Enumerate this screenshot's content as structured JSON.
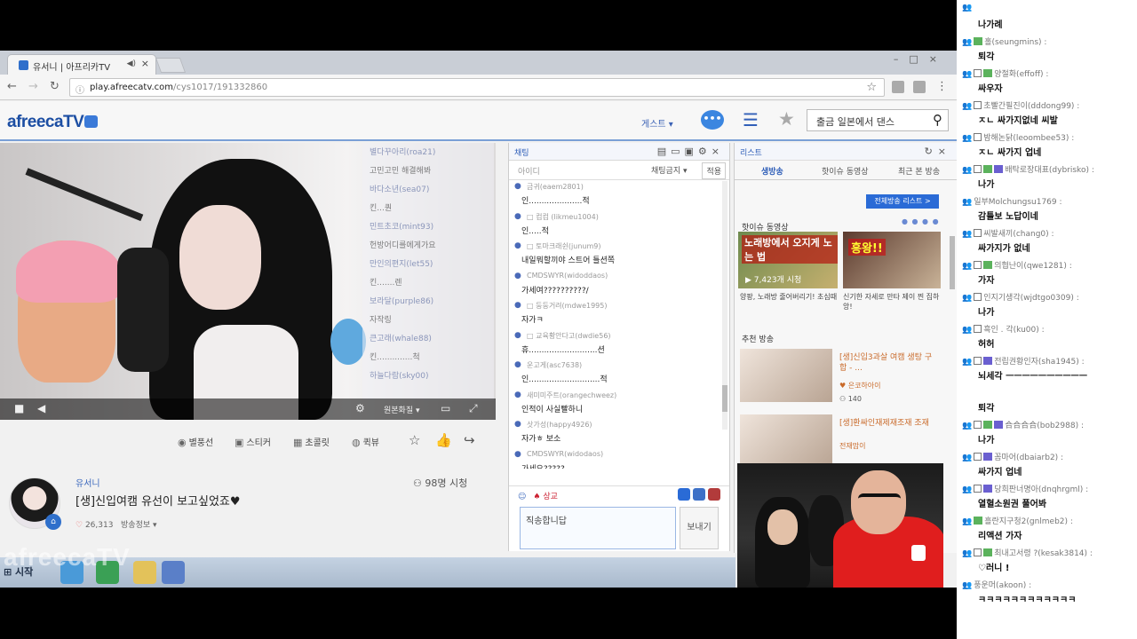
{
  "browser": {
    "tab_title": "유서니 | 아프리카TV",
    "address_host": "play.afreecatv.com",
    "address_path": "/cys1017/191332860"
  },
  "site": {
    "logo": "afreecaTV",
    "guest_label": "게스트 ▾",
    "search_value": "출금 일본에서 댄스"
  },
  "video": {
    "quality_label": "원본화질 ▾",
    "overlay_chat": [
      {
        "nick": "별다꾸아리(roa21)",
        "msg": ""
      },
      {
        "nick": "",
        "msg": "고민고민 해결해봐"
      },
      {
        "nick": "바다소년(sea07)",
        "msg": ""
      },
      {
        "nick": "",
        "msg": "킨...퀀"
      },
      {
        "nick": "민트초코(mint93)",
        "msg": ""
      },
      {
        "nick": "",
        "msg": "헌방어디를에게가요"
      },
      {
        "nick": "만인의편지(let55)",
        "msg": ""
      },
      {
        "nick": "",
        "msg": "킨.......렌"
      },
      {
        "nick": "보라달(purple86)",
        "msg": ""
      },
      {
        "nick": "",
        "msg": "자작링"
      },
      {
        "nick": "큰고래(whale88)",
        "msg": ""
      },
      {
        "nick": "",
        "msg": "킨..............척"
      },
      {
        "nick": "하늘다람(sky00)",
        "msg": ""
      }
    ]
  },
  "actions": {
    "broadcast": "별풍선",
    "sticker": "스티커",
    "chocolate": "초콜릿",
    "quickview": "퀵뷰"
  },
  "streamer": {
    "name": "유서니",
    "title": "[생]신입여캠 유선이 보고싶었죠♥",
    "recommend_count": "26,313",
    "info_label": "방송정보 ▾",
    "viewers": "98명 시청"
  },
  "chat": {
    "title": "채팅",
    "id_placeholder": "아이디",
    "select_label": "채팅금지 ▾",
    "apply_label": "적용",
    "messages": [
      {
        "nick": "금귀(eaem2801)",
        "msg": "인.....................적"
      },
      {
        "nick": "□ 컴컴 (likmeu1004)",
        "msg": "인.....적"
      },
      {
        "nick": "□ 토마크래쉰(junum9)",
        "msg": "내일뭐할끼야 스트어 틀션쪽"
      },
      {
        "nick": "CMDSWYR(widoddaos)",
        "msg": "가세여??????????/"
      },
      {
        "nick": "□ 둥둥거려(mdwe1995)",
        "msg": "자가ㅋ"
      },
      {
        "nick": "□ 교육황안다고(dwdie56)",
        "msg": "휴...........................션"
      },
      {
        "nick": "운고게(asc7638)",
        "msg": "인............................적"
      },
      {
        "nick": "새미미주트(orangechweez)",
        "msg": "인적이 사실빨하니"
      },
      {
        "nick": "삿가성(happy4926)",
        "msg": "자가ㅎ 보소"
      },
      {
        "nick": "CMDSWYR(widodaos)",
        "msg": "가세요?????"
      }
    ],
    "gift_label": "상교",
    "input_value": "직송합니답",
    "send_label": "보내기"
  },
  "list": {
    "title": "리스트",
    "tabs": [
      "생방송",
      "핫이슈 동영상",
      "최근 본 방송"
    ],
    "full_button": "전체방송 리스트 >",
    "hot_section": "핫이슈 동영상",
    "thumb1_text": "노래방에서 오지게 노는 법",
    "thumb1_count": "▶ 7,423개 시청",
    "thumb2_text": "흥왕!!",
    "caption1": "양팡, 노래방 줄어버리기! 초심때",
    "caption2": "신기한 자세로 만타 제이 찐 집하앙!",
    "rec_section": "추천 방송",
    "rec": [
      {
        "title": "[생]신입3과살 여캠 생탕 구합 - ...",
        "name": "♥ 은코하아이",
        "views": "140"
      },
      {
        "title": "[생]환싸인재제재조재 조재",
        "name": "전재맘이",
        "views": ""
      }
    ]
  },
  "taskbar": {
    "start_label": "시작"
  },
  "watermark": "afreecaTV",
  "external_chat": [
    {
      "user": "",
      "msg": "나가례",
      "badges": [
        "av"
      ]
    },
    {
      "user": "홀(seungmins)",
      "msg": "퇴각",
      "badges": [
        "av",
        "gr"
      ]
    },
    {
      "user": "양절화(effoff)",
      "msg": "싸우자",
      "badges": [
        "av",
        "bd",
        "gr"
      ]
    },
    {
      "user": "초빨간필진이(dddong99)",
      "msg": "ㅈㄴ 싸가지없네 씨발",
      "badges": [
        "av",
        "bd"
      ]
    },
    {
      "user": "밤해논닭(leoombee53)",
      "msg": "ㅈㄴ 싸가지 업네",
      "badges": [
        "av",
        "bd"
      ]
    },
    {
      "user": "배탁로장대표(dybrisko)",
      "msg": "나가",
      "badges": [
        "av",
        "bd",
        "gr",
        "pu"
      ]
    },
    {
      "user": "일부Molchungsu1769",
      "msg": "감틀보 노답이네",
      "badges": [
        "av"
      ]
    },
    {
      "user": "씨발새끼(chang0)",
      "msg": "싸가지가 없네",
      "badges": [
        "av",
        "bd"
      ]
    },
    {
      "user": "의협난이(qwe1281)",
      "msg": "가자",
      "badges": [
        "av",
        "bd",
        "gr"
      ]
    },
    {
      "user": "인지기생각(wjdtgo0309)",
      "msg": "나가",
      "badges": [
        "av",
        "bd"
      ]
    },
    {
      "user": "흑인 . 각(ku00)",
      "msg": "허허",
      "badges": [
        "av",
        "bd"
      ]
    },
    {
      "user": "전립권황인자(sha1945)",
      "msg": "뇌세각 ㅡㅡㅡㅡㅡㅡㅡㅡㅡㅡ",
      "badges": [
        "av",
        "bd",
        "pu"
      ]
    },
    {
      "user": "",
      "msg": "퇴각",
      "badges": []
    },
    {
      "user": "合合合合(bob2988)",
      "msg": "나가",
      "badges": [
        "av",
        "bd",
        "gr",
        "pu"
      ]
    },
    {
      "user": "꼼마어(dbaiarb2)",
      "msg": "싸가지 업네",
      "badges": [
        "av",
        "bd",
        "pu"
      ]
    },
    {
      "user": "당희판너명아(dnqhrgml)",
      "msg": "열혈소원권 풀어봐",
      "badges": [
        "av",
        "bd",
        "pu"
      ]
    },
    {
      "user": "흘란지구청2(gnlmeb2)",
      "msg": "리액션 가자",
      "badges": [
        "av",
        "gr"
      ]
    },
    {
      "user": "최내고서령 ?(kesak3814)",
      "msg": "♡러니 !",
      "badges": [
        "av",
        "bd",
        "gr"
      ]
    },
    {
      "user": "풍운머(akoon)",
      "msg": "ㅋㅋㅋㅋㅋㅋㅋㅋㅋㅋㅋㅋ",
      "badges": [
        "av"
      ]
    }
  ]
}
